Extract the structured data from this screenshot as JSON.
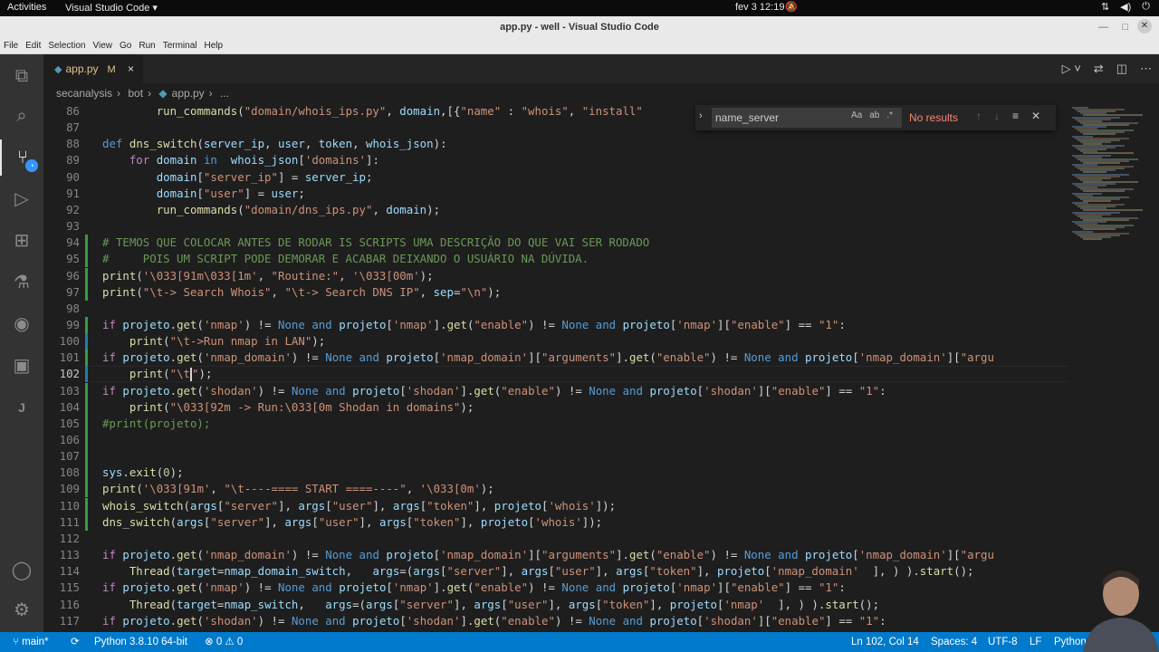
{
  "system_bar": {
    "activities": "Activities",
    "app_menu": "Visual Studio Code ▾",
    "clock": "fev 3  12:19"
  },
  "window": {
    "title": "app.py - well - Visual Studio Code"
  },
  "menu": [
    "File",
    "Edit",
    "Selection",
    "View",
    "Go",
    "Run",
    "Terminal",
    "Help"
  ],
  "activity_bar": [
    {
      "icon": "explorer-icon",
      "glyph": "⧉"
    },
    {
      "icon": "search-icon",
      "glyph": "⌕"
    },
    {
      "icon": "source-control-icon",
      "glyph": "⑂"
    },
    {
      "icon": "run-debug-icon",
      "glyph": "▷"
    },
    {
      "icon": "extensions-icon",
      "glyph": "⊞"
    },
    {
      "icon": "testing-icon",
      "glyph": "⚗"
    },
    {
      "icon": "github-icon",
      "glyph": "◉"
    },
    {
      "icon": "remote-explorer-icon",
      "glyph": "▣"
    },
    {
      "icon": "json-icon",
      "glyph": "J"
    },
    {
      "icon": "accounts-icon",
      "glyph": "◯"
    },
    {
      "icon": "manage-gear-icon",
      "glyph": "⚙"
    }
  ],
  "tab": {
    "label": "app.py",
    "modified": "M",
    "close": "×"
  },
  "breadcrumb": [
    "secanalysis",
    "bot",
    "app.py",
    "..."
  ],
  "find": {
    "value": "name_server",
    "match_case": "Aa",
    "whole_word": "ab",
    "regex": ".*",
    "result": "No results"
  },
  "editor": {
    "current_line": 102,
    "lines": [
      {
        "n": 86,
        "indent": 0,
        "code": "        run_commands(\"domain/whois_ips.py\", domain,[{\"name\" : \"whois\", \"install\""
      },
      {
        "n": 87,
        "code": ""
      },
      {
        "n": 88,
        "code": "def dns_switch(server_ip, user, token, whois_json):"
      },
      {
        "n": 89,
        "code": "    for domain in  whois_json['domains']:"
      },
      {
        "n": 90,
        "code": "        domain[\"server_ip\"] = server_ip;"
      },
      {
        "n": 91,
        "code": "        domain[\"user\"] = user;"
      },
      {
        "n": 92,
        "code": "        run_commands(\"domain/dns_ips.py\", domain);"
      },
      {
        "n": 93,
        "code": ""
      },
      {
        "n": 94,
        "code": "# TEMOS QUE COLOCAR ANTES DE RODAR IS SCRIPTS UMA DESCRIÇÃO DO QUE VAI SER RODADO"
      },
      {
        "n": 95,
        "code": "#     POIS UM SCRIPT PODE DEMORAR E ACABAR DEIXANDO O USUÁRIO NA DÚVIDA."
      },
      {
        "n": 96,
        "code": "print('\\033[91m\\033[1m', \"Routine:\", '\\033[00m');"
      },
      {
        "n": 97,
        "code": "print(\"\\t-> Search Whois\", \"\\t-> Search DNS IP\", sep=\"\\n\");"
      },
      {
        "n": 98,
        "code": ""
      },
      {
        "n": 99,
        "code": "if projeto.get('nmap') != None and projeto['nmap'].get(\"enable\") != None and projeto['nmap'][\"enable\"] == \"1\":"
      },
      {
        "n": 100,
        "code": "    print(\"\\t->Run nmap in LAN\");"
      },
      {
        "n": 101,
        "code": "if projeto.get('nmap_domain') != None and projeto['nmap_domain'][\"arguments\"].get(\"enable\") != None and projeto['nmap_domain'][\"argu"
      },
      {
        "n": 102,
        "code": "    print(\"\\t\");"
      },
      {
        "n": 103,
        "code": "if projeto.get('shodan') != None and projeto['shodan'].get(\"enable\") != None and projeto['shodan'][\"enable\"] == \"1\":"
      },
      {
        "n": 104,
        "code": "    print(\"\\033[92m -> Run:\\033[0m Shodan in domains\");"
      },
      {
        "n": 105,
        "code": "#print(projeto);"
      },
      {
        "n": 106,
        "code": ""
      },
      {
        "n": 107,
        "code": ""
      },
      {
        "n": 108,
        "code": "sys.exit(0);"
      },
      {
        "n": 109,
        "code": "print('\\033[91m', \"\\t----==== START ====----\", '\\033[0m');"
      },
      {
        "n": 110,
        "code": "whois_switch(args[\"server\"], args[\"user\"], args[\"token\"], projeto['whois']);"
      },
      {
        "n": 111,
        "code": "dns_switch(args[\"server\"], args[\"user\"], args[\"token\"], projeto['whois']);"
      },
      {
        "n": 112,
        "code": ""
      },
      {
        "n": 113,
        "code": "if projeto.get('nmap_domain') != None and projeto['nmap_domain'][\"arguments\"].get(\"enable\") != None and projeto['nmap_domain'][\"argu"
      },
      {
        "n": 114,
        "code": "    Thread(target=nmap_domain_switch,   args=(args[\"server\"], args[\"user\"], args[\"token\"], projeto['nmap_domain'  ], ) ).start();"
      },
      {
        "n": 115,
        "code": "if projeto.get('nmap') != None and projeto['nmap'].get(\"enable\") != None and projeto['nmap'][\"enable\"] == \"1\":"
      },
      {
        "n": 116,
        "code": "    Thread(target=nmap_switch,   args=(args[\"server\"], args[\"user\"], args[\"token\"], projeto['nmap'  ], ) ).start();"
      },
      {
        "n": 117,
        "code": "if projeto.get('shodan') != None and projeto['shodan'].get(\"enable\") != None and projeto['shodan'][\"enable\"] == \"1\":"
      }
    ]
  },
  "status": {
    "branch": "main*",
    "interpreter": "Python 3.8.10 64-bit",
    "problems": "⊗ 0 ⚠ 0",
    "position": "Ln 102, Col 14",
    "spaces": "Spaces: 4",
    "encoding": "UTF-8",
    "eol": "LF",
    "language": "Python"
  },
  "colors": {
    "statusbar": "#007acc",
    "editor_bg": "#1e1e1e",
    "keyword": "#569cd6",
    "string": "#ce9178",
    "comment": "#6a9955",
    "function": "#dcdcaa"
  }
}
